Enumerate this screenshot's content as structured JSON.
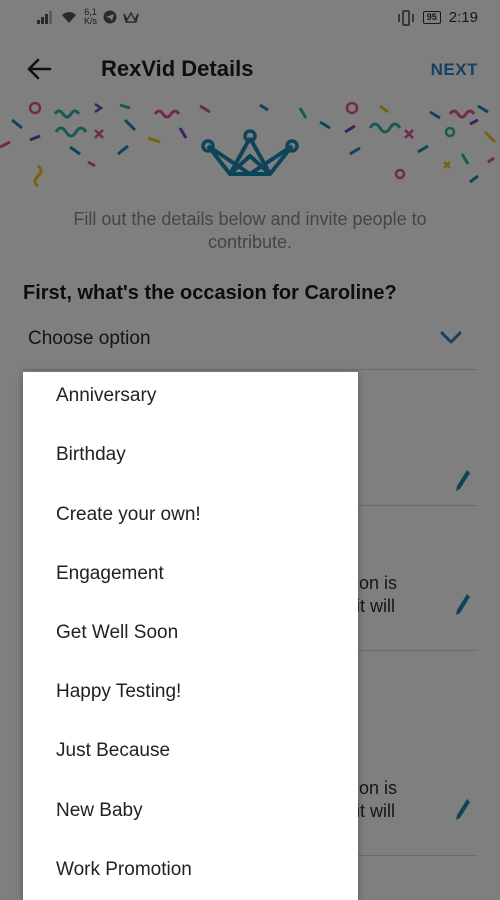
{
  "status_bar": {
    "net_speed_value": "6,1",
    "net_speed_unit": "K/s",
    "battery": "95",
    "time": "2:19"
  },
  "app_bar": {
    "title": "RexVid Details",
    "next_label": "NEXT"
  },
  "intro_text": "Fill out the details below and invite people to contribute.",
  "occasion": {
    "question": "First, what's the occasion for Caroline?",
    "placeholder": "Choose option",
    "options": [
      "Anniversary",
      "Birthday",
      "Create your own!",
      "Engagement",
      "Get Well Soon",
      "Happy Testing!",
      "Just Because",
      "New Baby",
      "Work Promotion"
    ]
  },
  "background_fields": {
    "field_2_line_1": "sion is",
    "field_2_line_2": "dit will",
    "field_3_line_1": "sion is",
    "field_3_line_2": "dit will"
  },
  "colors": {
    "accent": "#2b80c5",
    "crown": "#1a8ab0",
    "scrim": "rgba(0,0,0,0.5)"
  }
}
